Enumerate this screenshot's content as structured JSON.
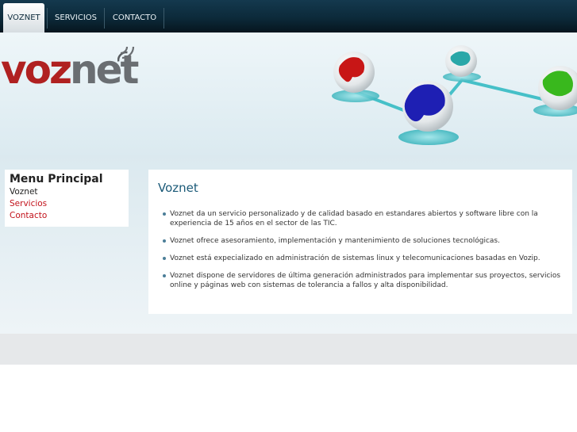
{
  "nav": {
    "tabs": [
      {
        "label": "VOZNET",
        "active": true
      },
      {
        "label": "SERVICIOS",
        "active": false
      },
      {
        "label": "CONTACTO",
        "active": false
      }
    ]
  },
  "logo": {
    "part1": "voz",
    "part2": "net"
  },
  "sidebar": {
    "title": "Menu Principal",
    "items": [
      {
        "label": "Voznet",
        "current": true
      },
      {
        "label": "Servicios",
        "current": false
      },
      {
        "label": "Contacto",
        "current": false
      }
    ]
  },
  "main": {
    "title": "Voznet",
    "bullets": [
      "Voznet da un servicio personalizado y de calidad basado en estandares abiertos y software libre con la experiencia de 15 años en el sector de las TIC.",
      "Voznet ofrece asesoramiento, implementación y mantenimiento de soluciones tecnológicas.",
      "Voznet está expecializado en administración de sistemas linux y telecomunicaciones basadas en Vozip.",
      "Voznet dispone de servidores de última generación administrados para implementar sus proyectos, servicios online y páginas web con sistemas de tolerancia a fallos y alta disponibilidad."
    ]
  },
  "colors": {
    "brand_red": "#b02121",
    "nav_dark": "#0c2a3a",
    "title_blue": "#1b5a78",
    "link_red": "#c2121b"
  }
}
